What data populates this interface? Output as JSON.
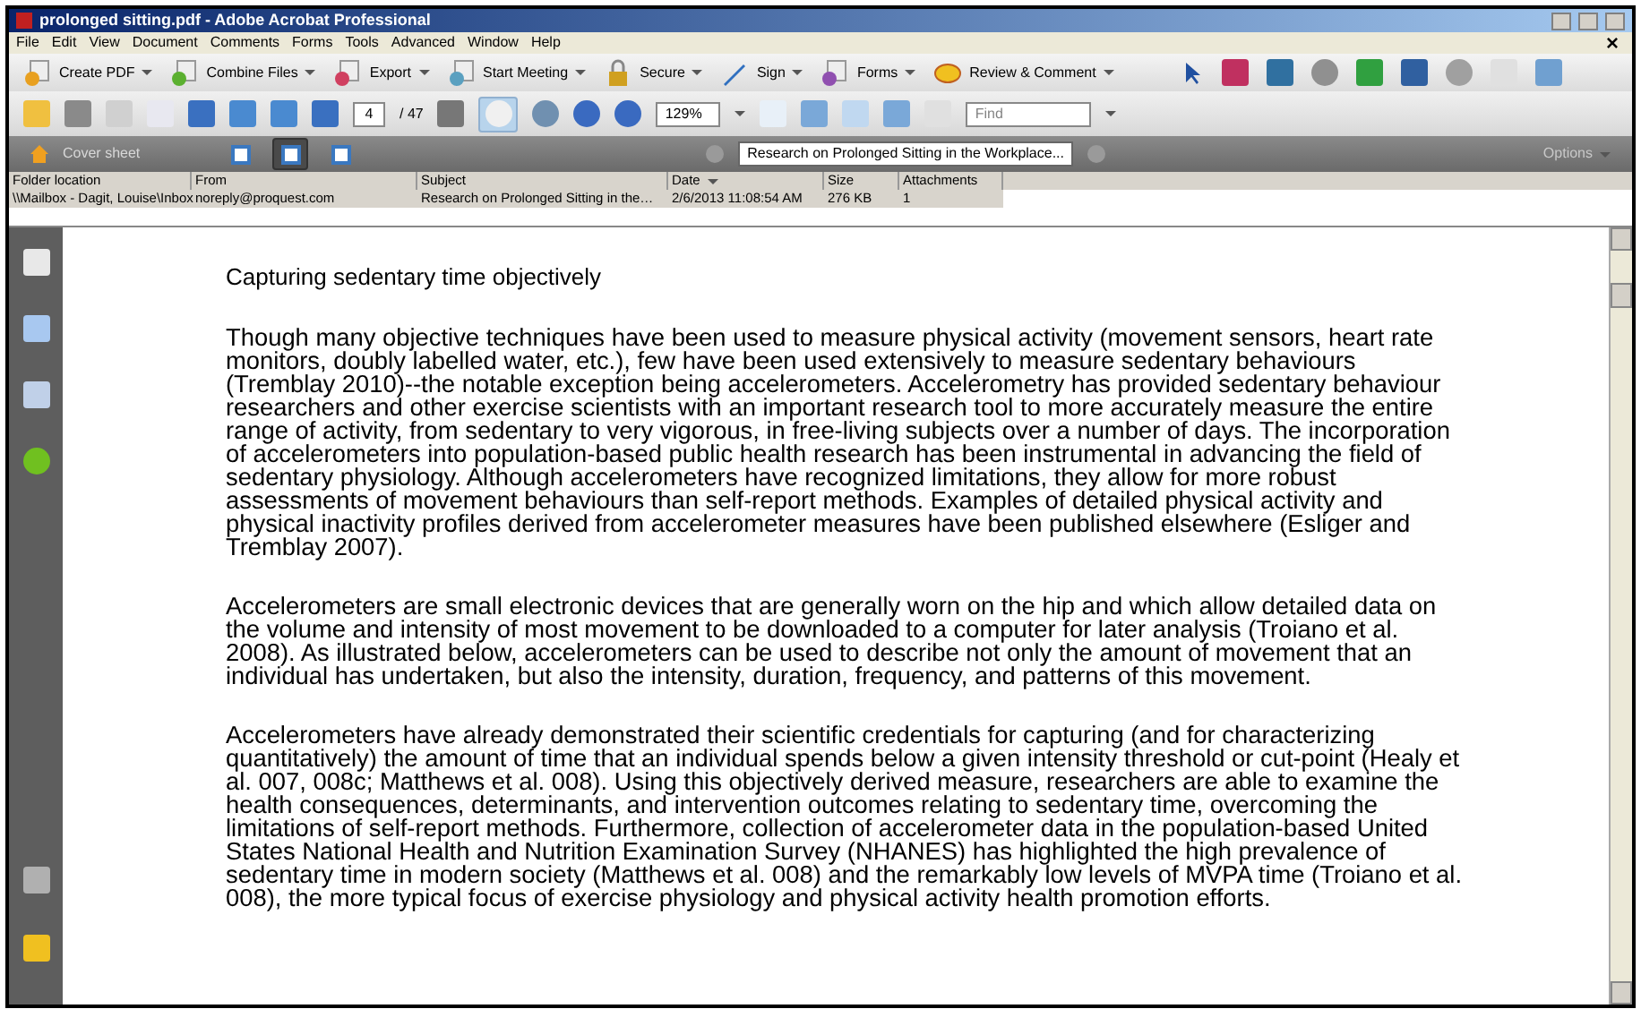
{
  "window": {
    "title": "prolonged sitting.pdf - Adobe Acrobat Professional"
  },
  "menu": [
    "File",
    "Edit",
    "View",
    "Document",
    "Comments",
    "Forms",
    "Tools",
    "Advanced",
    "Window",
    "Help"
  ],
  "task_buttons": [
    {
      "label": "Create PDF",
      "kind": "create"
    },
    {
      "label": "Combine Files",
      "kind": "combine"
    },
    {
      "label": "Export",
      "kind": "export"
    },
    {
      "label": "Start Meeting",
      "kind": "meeting"
    },
    {
      "label": "Secure",
      "kind": "secure"
    },
    {
      "label": "Sign",
      "kind": "sign"
    },
    {
      "label": "Forms",
      "kind": "forms"
    },
    {
      "label": "Review & Comment",
      "kind": "review"
    }
  ],
  "navigation": {
    "page": "4",
    "page_count": "/ 47",
    "zoom": "129%",
    "find_placeholder": "Find"
  },
  "portfolio_bar": {
    "cover_sheet": "Cover sheet",
    "layouts": [
      {
        "selected": false
      },
      {
        "selected": true
      },
      {
        "selected": false
      }
    ],
    "subject": "Research on Prolonged Sitting in the Workplace...",
    "options": "Options"
  },
  "table": {
    "columns": [
      "Folder location",
      "From",
      "Subject",
      "Date",
      "Size",
      "Attachments"
    ],
    "rows": [
      [
        "\\\\Mailbox - Dagit, Louise\\Inbox",
        "noreply@proquest.com",
        "Research on Prolonged Sitting in the…",
        "2/6/2013 11:08:54 AM",
        "276 KB",
        "1"
      ]
    ]
  },
  "document": {
    "heading": "Capturing sedentary time objectively",
    "paragraphs": [
      "Though many objective techniques have been used to measure physical activity (movement sensors, heart rate monitors, doubly labelled water, etc.), few have been used extensively to measure sedentary behaviours (Tremblay 2010)--the notable exception being accelerometers. Accelerometry has provided sedentary behaviour researchers and other exercise scientists with an important research tool to more accurately measure the entire range of activity, from sedentary to very vigorous, in free-living subjects over a number of days. The incorporation of accelerometers into population-based public health research has been instrumental in advancing the field of sedentary physiology. Although accelerometers have recognized limitations, they allow for more robust assessments of movement behaviours than self-report methods. Examples of detailed physical activity and physical inactivity profiles derived from accelerometer measures have been published elsewhere (Esliger and Tremblay 2007).",
      "Accelerometers are small electronic devices that are generally worn on the hip and which allow detailed data on the volume and intensity of most movement to be downloaded to a computer for later analysis (Troiano et al. 2008). As illustrated below, accelerometers can be used to describe not only the amount of movement that an individual has undertaken, but also the intensity, duration, frequency, and patterns of this movement.",
      "Accelerometers have already demonstrated their scientific credentials for capturing (and for characterizing quantitatively) the amount of time that an individual spends below a given intensity threshold or cut-point (Healy et al. 007, 008c; Matthews et al. 008). Using this objectively derived measure, researchers are able to examine the health consequences, determinants, and intervention outcomes relating to sedentary time, overcoming the limitations of self-report methods. Furthermore, collection of accelerometer data in the population-based United States National Health and Nutrition Examination Survey (NHANES) has highlighted the high prevalence of sedentary time in modern society (Matthews et al. 008) and the remarkably low levels of MVPA time (Troiano et al. 008), the more typical focus of exercise physiology and physical activity health promotion efforts."
    ]
  }
}
